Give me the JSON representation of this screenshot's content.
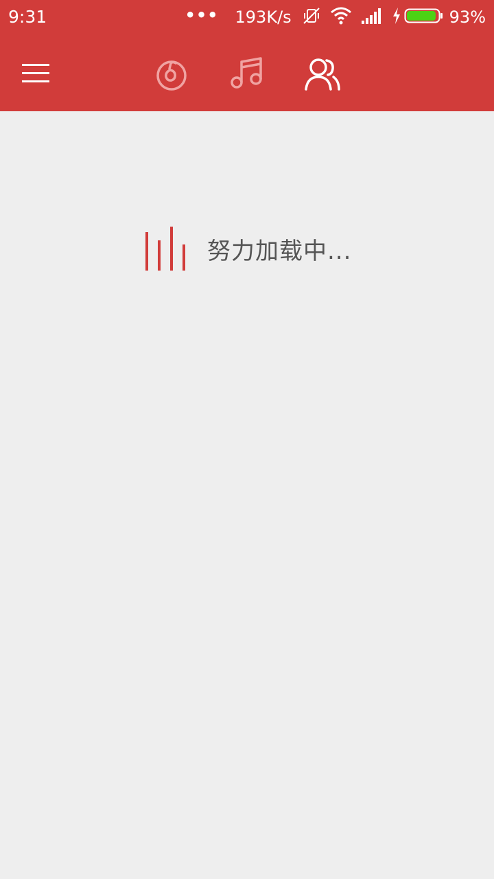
{
  "status_bar": {
    "time": "9:31",
    "dots": "•••",
    "network_speed": "193K/s",
    "battery_percent": "93%",
    "battery_level": 0.93,
    "icons": [
      "mute-vibrate-icon",
      "wifi-icon",
      "signal-icon",
      "charging-icon",
      "battery-icon"
    ]
  },
  "nav": {
    "menu_icon": "hamburger-menu-icon",
    "tabs": [
      {
        "icon": "discover-music-icon",
        "active": false
      },
      {
        "icon": "my-music-icon",
        "active": false
      },
      {
        "icon": "friends-icon",
        "active": true
      }
    ]
  },
  "loading": {
    "text": "努力加载中..."
  },
  "colors": {
    "primary": "#d13c3a",
    "background": "#eeeeee",
    "text_gray": "#555555",
    "battery_green": "#4cd214"
  }
}
